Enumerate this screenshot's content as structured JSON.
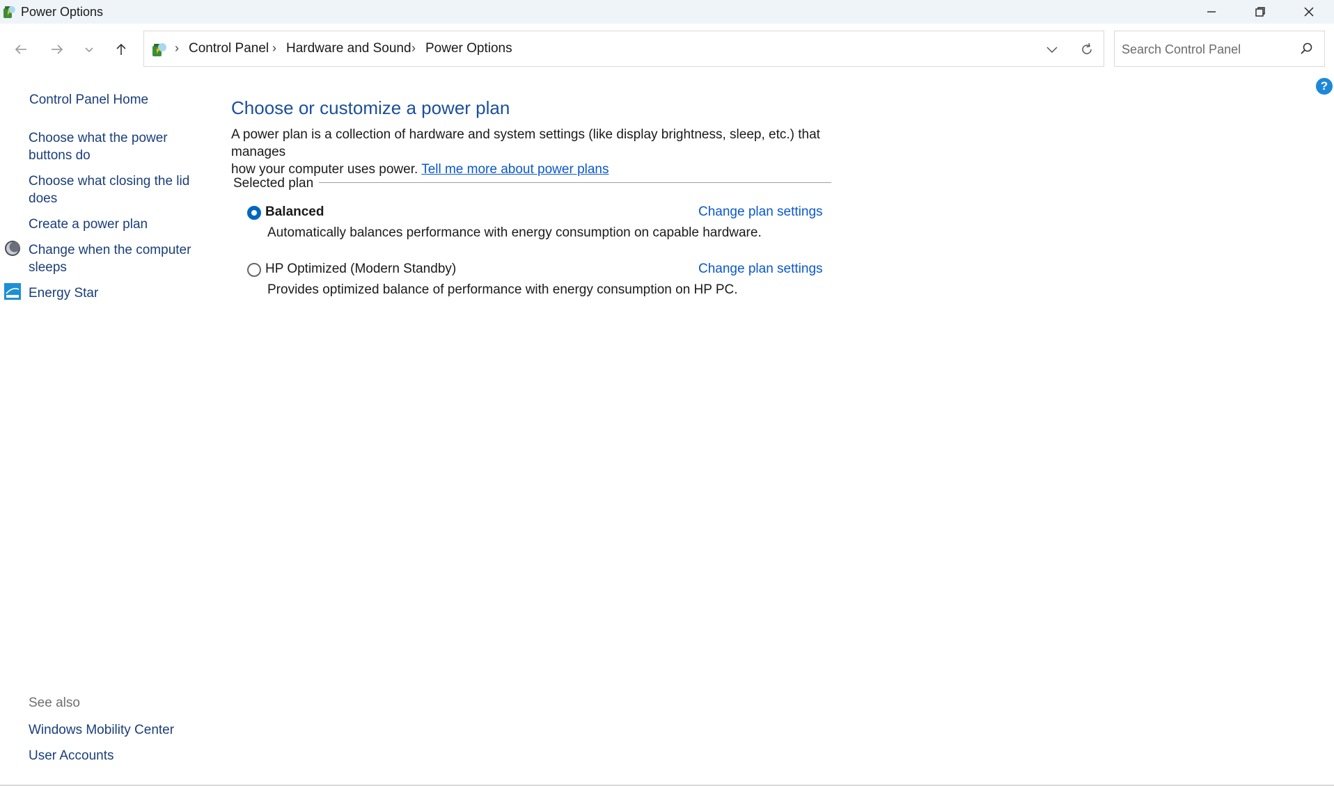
{
  "window": {
    "title": "Power Options",
    "minimize_icon": "minimize-icon",
    "restore_icon": "restore-icon",
    "close_icon": "close-icon"
  },
  "nav": {
    "back_icon": "back-arrow-icon",
    "forward_icon": "forward-arrow-icon",
    "recent_icon": "chevron-down-icon",
    "up_icon": "up-arrow-icon",
    "breadcrumbs": [
      "Control Panel",
      "Hardware and Sound",
      "Power Options"
    ],
    "dropdown_icon": "chevron-down-icon",
    "refresh_icon": "refresh-icon"
  },
  "search": {
    "placeholder": "Search Control Panel",
    "value": ""
  },
  "help": {
    "label": "?"
  },
  "sidebar": {
    "home": "Control Panel Home",
    "links": [
      {
        "label_line1": "Choose what the power",
        "label_line2": "buttons do"
      },
      {
        "label_line1": "Choose what closing the lid",
        "label_line2": "does"
      },
      {
        "label_line1": "Create a power plan",
        "label_line2": ""
      },
      {
        "label_line1": "Change when the computer",
        "label_line2": "sleeps",
        "icon": "moon-sleep-icon"
      },
      {
        "label_line1": "Energy Star",
        "label_line2": "",
        "icon": "energy-star-icon"
      }
    ],
    "see_also_label": "See also",
    "see_also": [
      "Windows Mobility Center",
      "User Accounts"
    ]
  },
  "main": {
    "heading": "Choose or customize a power plan",
    "description_line1": "A power plan is a collection of hardware and system settings (like display brightness, sleep, etc.) that manages",
    "description_line2": "how your computer uses power.",
    "more_link": "Tell me more about power plans",
    "group_label": "Selected plan",
    "plans": [
      {
        "name": "Balanced",
        "selected": true,
        "description": "Automatically balances performance with energy consumption on capable hardware.",
        "change_link": "Change plan settings"
      },
      {
        "name": "HP Optimized (Modern Standby)",
        "selected": false,
        "description": "Provides optimized balance of performance with energy consumption on HP PC.",
        "change_link": "Change plan settings"
      }
    ]
  }
}
